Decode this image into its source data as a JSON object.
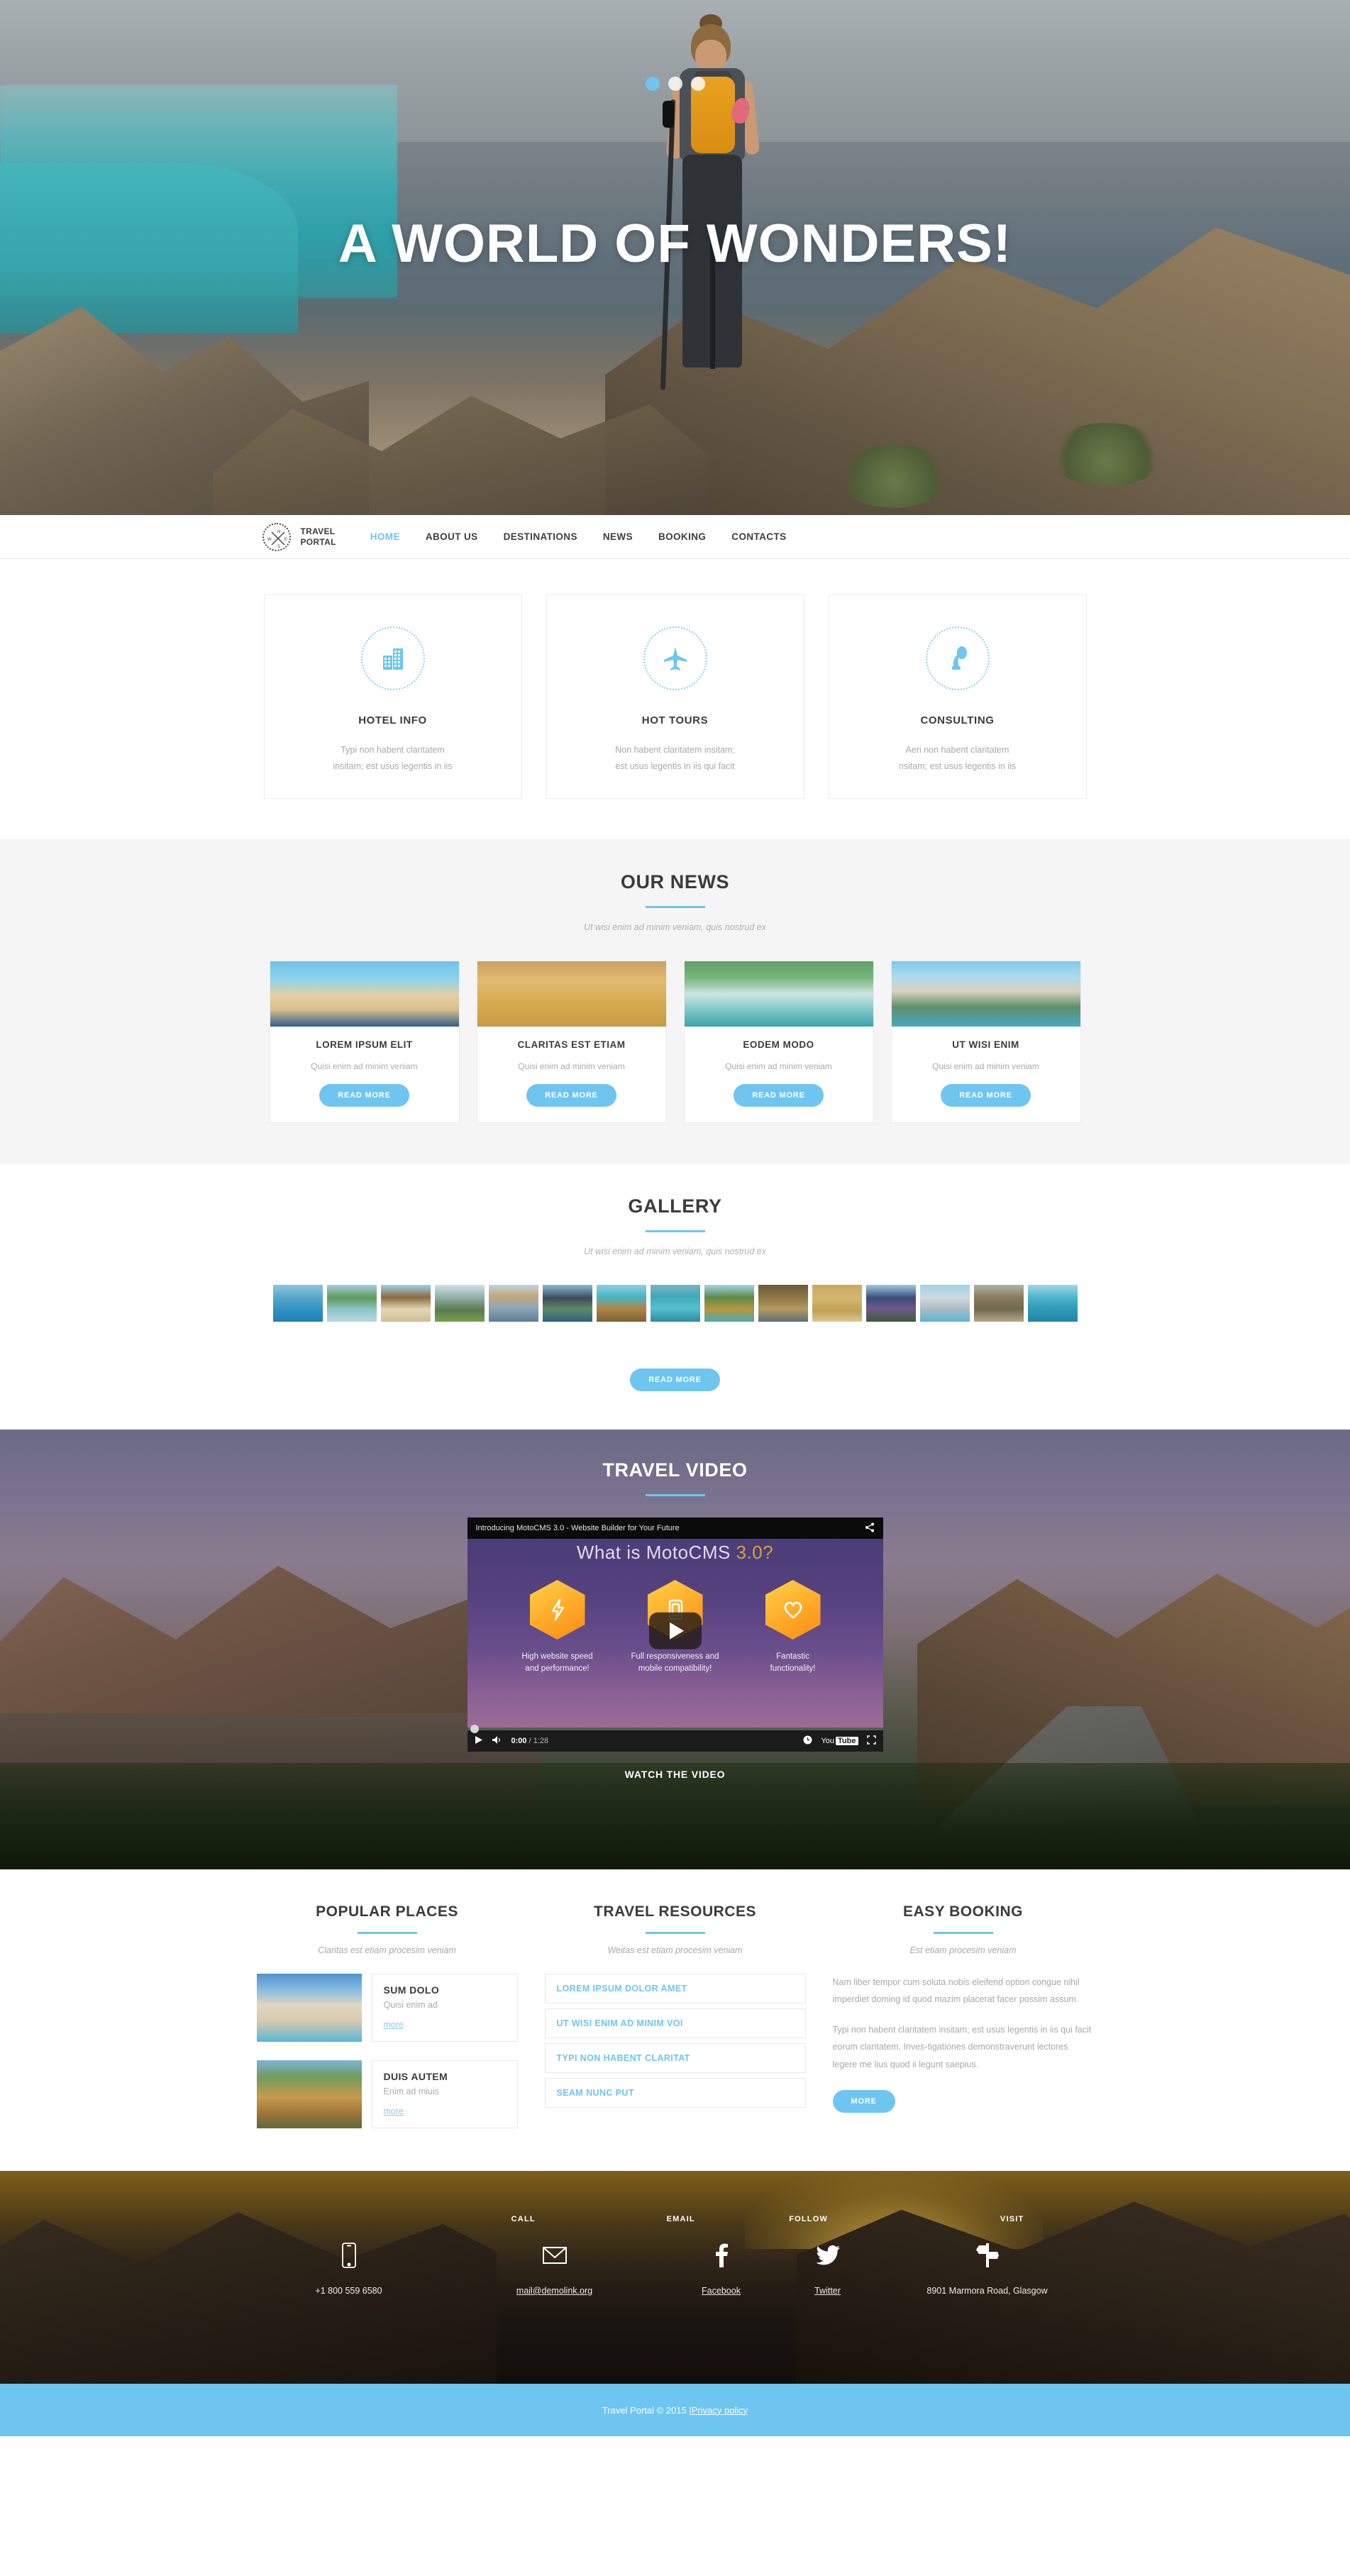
{
  "hero": {
    "title": "A WORLD OF WONDERS!",
    "dots": 3,
    "active_dot": 0
  },
  "header": {
    "logo_line1": "TRAVEL",
    "logo_line2": "PORTAL",
    "logo_icon": "compass-icon",
    "nav": [
      {
        "label": "HOME",
        "active": true
      },
      {
        "label": "ABOUT US",
        "active": false
      },
      {
        "label": "DESTINATIONS",
        "active": false
      },
      {
        "label": "NEWS",
        "active": false
      },
      {
        "label": "BOOKING",
        "active": false
      },
      {
        "label": "CONTACTS",
        "active": false
      }
    ]
  },
  "services": [
    {
      "icon": "buildings-icon",
      "title": "HOTEL INFO",
      "line1": "Typi non habent claritatem",
      "line2": "insitam; est usus legentis in iis"
    },
    {
      "icon": "airplane-icon",
      "title": "HOT TOURS",
      "line1": "Non habent claritatem insitam;",
      "line2": "est usus legentis in iis qui facit"
    },
    {
      "icon": "microphone-icon",
      "title": "CONSULTING",
      "line1": "Aeri non habent claritatem",
      "line2": "nsitam; est usus legentis in iis"
    }
  ],
  "news": {
    "title": "OUR NEWS",
    "subtitle": "Ut wisi enim ad minim veniam, quis nostrud ex",
    "cards": [
      {
        "title": "LOREM IPSUM ELIT",
        "text": "Quisi enim ad minim veniam",
        "button": "READ MORE",
        "image": "beach-loungers-photo"
      },
      {
        "title": "CLARITAS EST ETIAM",
        "text": "Quisi enim ad minim veniam",
        "button": "READ MORE",
        "image": "message-in-bottle-photo"
      },
      {
        "title": "EODEM MODO",
        "text": "Quisi enim ad minim veniam",
        "button": "READ MORE",
        "image": "waterfall-photo"
      },
      {
        "title": "UT WISI ENIM",
        "text": "Quisi enim ad minim veniam",
        "button": "READ MORE",
        "image": "resort-pool-photo"
      }
    ]
  },
  "gallery": {
    "title": "GALLERY",
    "subtitle": "Ut wisi enim ad minim veniam, quis nostrud ex",
    "button": "READ MORE",
    "thumbs": [
      "overwater-bungalow",
      "tropical-island",
      "beach-umbrella",
      "mountain-lake",
      "venice-canal",
      "lake-chapel",
      "beach-pier",
      "infinity-pool",
      "thai-temple",
      "venice-bridge",
      "pyramid",
      "thai-palace",
      "hotel-facade",
      "hillside-village",
      "overwater-huts"
    ]
  },
  "video": {
    "title": "TRAVEL VIDEO",
    "watch_label": "WATCH THE VIDEO",
    "player": {
      "bar_title": "Introducing MotoCMS 3.0 - Website Builder for Your Future",
      "share_icon": "share-icon",
      "stage_heading_main": "What is MotoCMS ",
      "stage_heading_gold": "3.0?",
      "features": [
        {
          "icon": "lightning-icon",
          "caption_line1": "High website speed",
          "caption_line2": "and performance!"
        },
        {
          "icon": "mobile-icon",
          "caption_line1": "Full responsiveness and",
          "caption_line2": "mobile compatibility!"
        },
        {
          "icon": "heart-icon",
          "caption_line1": "Fantastic",
          "caption_line2": "functionality!"
        }
      ],
      "current_time": "0:00",
      "total_time": "1:28",
      "time_separator": "/",
      "brand_you": "You",
      "brand_tube": "Tube"
    }
  },
  "bottom": {
    "popular_places": {
      "title": "POPULAR PLACES",
      "subtitle": "Claritas est etiam procesim veniam",
      "items": [
        {
          "title": "SUM DOLO",
          "text": "Quisi enim ad",
          "more": "more",
          "image": "villa-pool-photo"
        },
        {
          "title": "DUIS AUTEM",
          "text": "Enim ad miuis",
          "more": "more",
          "image": "colosseum-photo"
        }
      ]
    },
    "travel_resources": {
      "title": "TRAVEL RESOURCES",
      "subtitle": "Weitas est etiam procesim veniam",
      "items": [
        "LOREM IPSUM DOLOR AMET",
        "UT WISI ENIM AD MINIM VOl",
        "TYPI NON HABENT CLARITAT",
        "SEAM NUNC PUT"
      ]
    },
    "easy_booking": {
      "title": "EASY BOOKING",
      "subtitle": "Est etiam procesim veniam",
      "paragraph1": "Nam liber tempor cum soluta nobis eleifend option congue nihil imperdiet doming id quod mazim placerat facer possim assum.",
      "paragraph2": "Typi non habent claritatem insitam; est usus legentis in iis qui facit eorum claritatem. Inves-tigationes demonstraverunt lectores legere me lius quod ii legunt saepius.",
      "button": "MORE"
    }
  },
  "footer": {
    "columns": [
      {
        "label": "CALL",
        "icon": "phone-icon",
        "value": "+1 800 559 6580"
      },
      {
        "label": "EMAIL",
        "icon": "envelope-icon",
        "value": "mail@demolink.org"
      },
      {
        "label": "FOLLOW",
        "icon": "facebook-icon",
        "value": "Facebook"
      },
      {
        "label": "",
        "icon": "twitter-icon",
        "value": "Twitter"
      },
      {
        "label": "VISIT",
        "icon": "signpost-icon",
        "value": "8901 Marmora Road, Glasgow"
      }
    ],
    "copyright_text": "Travel Portal © 2015  |  ",
    "privacy_link": "Privacy policy"
  },
  "colors": {
    "accent": "#6ec5f0",
    "heading": "#3b3b3b",
    "muted": "#a9a9a9",
    "news_bg": "#f5f5f5"
  }
}
